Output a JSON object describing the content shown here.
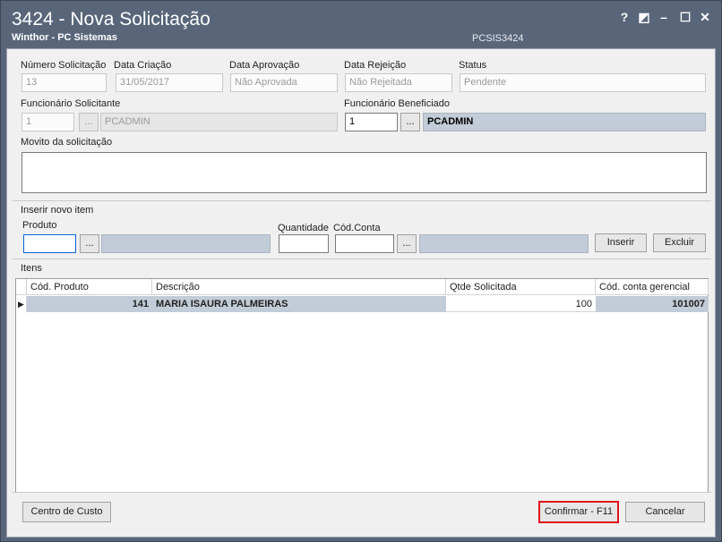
{
  "window": {
    "title": "3424 - Nova Solicitação",
    "subtitle": "Winthor - PC Sistemas",
    "program_code": "PCSIS3424",
    "controls": {
      "help": "?",
      "restore": "◩",
      "minimize": "–",
      "maximize": "☐",
      "close": "✕"
    }
  },
  "header": {
    "numero_label": "Número Solicitação",
    "numero_value": "13",
    "data_criacao_label": "Data Criação",
    "data_criacao_value": "31/05/2017",
    "data_aprovacao_label": "Data Aprovação",
    "data_aprovacao_value": "Não Aprovada",
    "data_rejeicao_label": "Data Rejeição",
    "data_rejeicao_value": "Não Rejeitada",
    "status_label": "Status",
    "status_value": "Pendente",
    "func_solicitante_label": "Funcionário Solicitante",
    "func_solicitante_code": "1",
    "func_solicitante_name": "PCADMIN",
    "func_beneficiado_label": "Funcionário Beneficiado",
    "func_beneficiado_code": "1",
    "func_beneficiado_name": "PCADMIN",
    "motivo_label": "Movito da solicitação",
    "lookup_label": "..."
  },
  "novo_item": {
    "group_title": "Inserir novo item",
    "produto_label": "Produto",
    "quantidade_label": "Quantidade",
    "cod_conta_label": "Cód.Conta",
    "inserir_label": "Inserir",
    "excluir_label": "Excluir"
  },
  "itens": {
    "group_title": "Itens",
    "columns": [
      "Cód. Produto",
      "Descrição",
      "Qtde Solicitada",
      "Cód. conta gerencial"
    ],
    "rows": [
      {
        "cod_produto": "141",
        "descricao": "MARIA ISAURA PALMEIRAS",
        "qtde": "100",
        "cod_conta": "101007"
      }
    ]
  },
  "footer": {
    "centro_custo_label": "Centro de Custo",
    "confirmar_label": "Confirmar - F11",
    "cancelar_label": "Cancelar"
  },
  "colors": {
    "titlebar": "#59667a",
    "selection": "#c2ccd8",
    "highlight": "#e0101a"
  }
}
